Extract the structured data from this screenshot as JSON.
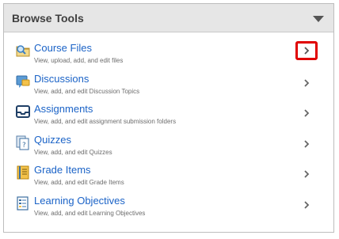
{
  "panel": {
    "title": "Browse Tools",
    "collapse_icon": "caret-down-icon"
  },
  "items": [
    {
      "title": "Course Files",
      "description": "View, upload, add, and edit files",
      "icon": "folder-magnifier-icon",
      "highlighted": true
    },
    {
      "title": "Discussions",
      "description": "View, add, and edit Discussion Topics",
      "icon": "discussion-bubble-icon",
      "highlighted": false
    },
    {
      "title": "Assignments",
      "description": "View, add, and edit assignment submission folders",
      "icon": "assignment-tray-icon",
      "highlighted": false
    },
    {
      "title": "Quizzes",
      "description": "View, add, and edit Quizzes",
      "icon": "quiz-document-icon",
      "highlighted": false
    },
    {
      "title": "Grade Items",
      "description": "View, add, and edit Grade Items",
      "icon": "gradebook-icon",
      "highlighted": false
    },
    {
      "title": "Learning Objectives",
      "description": "View, add, and edit Learning Objectives",
      "icon": "learning-objectives-icon",
      "highlighted": false
    }
  ],
  "colors": {
    "link": "#1b63c7",
    "highlight_border": "#e00000",
    "header_background": "#e6e6e6"
  }
}
